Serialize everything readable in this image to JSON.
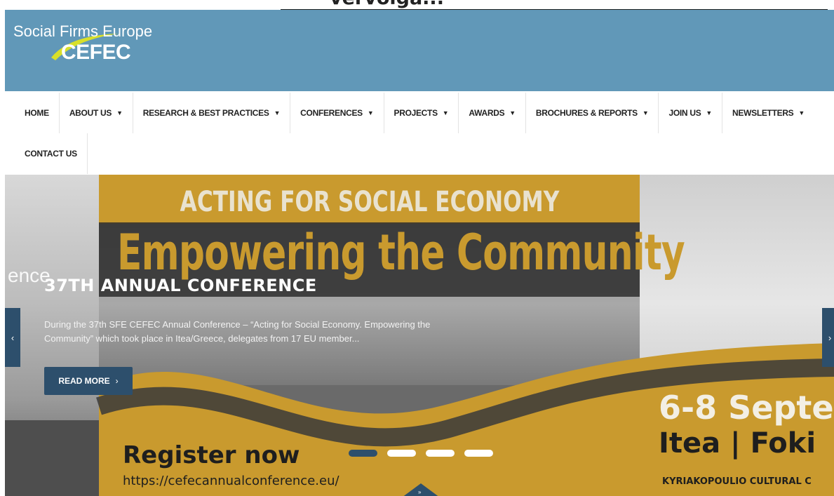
{
  "top_caption": "vervolga...",
  "logo": {
    "line1": "Social Firms Europe",
    "line2": "CEFEC"
  },
  "nav": {
    "row1": [
      {
        "label": "HOME",
        "dropdown": false
      },
      {
        "label": "ABOUT US",
        "dropdown": true
      },
      {
        "label": "RESEARCH & BEST PRACTICES",
        "dropdown": true
      },
      {
        "label": "CONFERENCES",
        "dropdown": true
      },
      {
        "label": "PROJECTS",
        "dropdown": true
      },
      {
        "label": "AWARDS",
        "dropdown": true
      },
      {
        "label": "BROCHURES & REPORTS",
        "dropdown": true
      },
      {
        "label": "JOIN US",
        "dropdown": true
      },
      {
        "label": "NEWSLETTERS",
        "dropdown": true
      }
    ],
    "row2": [
      {
        "label": "CONTACT US",
        "dropdown": false
      }
    ]
  },
  "hero": {
    "banner_line1": "ACTING FOR SOCIAL ECONOMY",
    "banner_line2": "Empowering the Community",
    "ghost_text": "ence",
    "slide_title": "37TH ANNUAL CONFERENCE",
    "slide_description": "During the 37th SFE CEFEC Annual Conference – “Acting for Social Economy. Empowering the Community” which took place in Itea/Greece, delegates from 17 EU member...",
    "read_more_label": "READ MORE",
    "register_label": "Register now",
    "register_url": "https://cefecannualconference.eu/",
    "dates": "6-8 Septe",
    "venue": "Itea | Foki",
    "venue2": "KYRIAKOPOULIO CULTURAL C",
    "slides_total": 4,
    "active_slide": 1
  },
  "icons": {
    "prev": "chevron-left-icon",
    "next": "chevron-right-icon",
    "caret": "caret-down-icon",
    "scroll": "chevron-down-icon"
  },
  "colors": {
    "header_bg": "#6198b8",
    "accent_dark_blue": "#2d4f6c",
    "gold": "#c99a2e"
  }
}
